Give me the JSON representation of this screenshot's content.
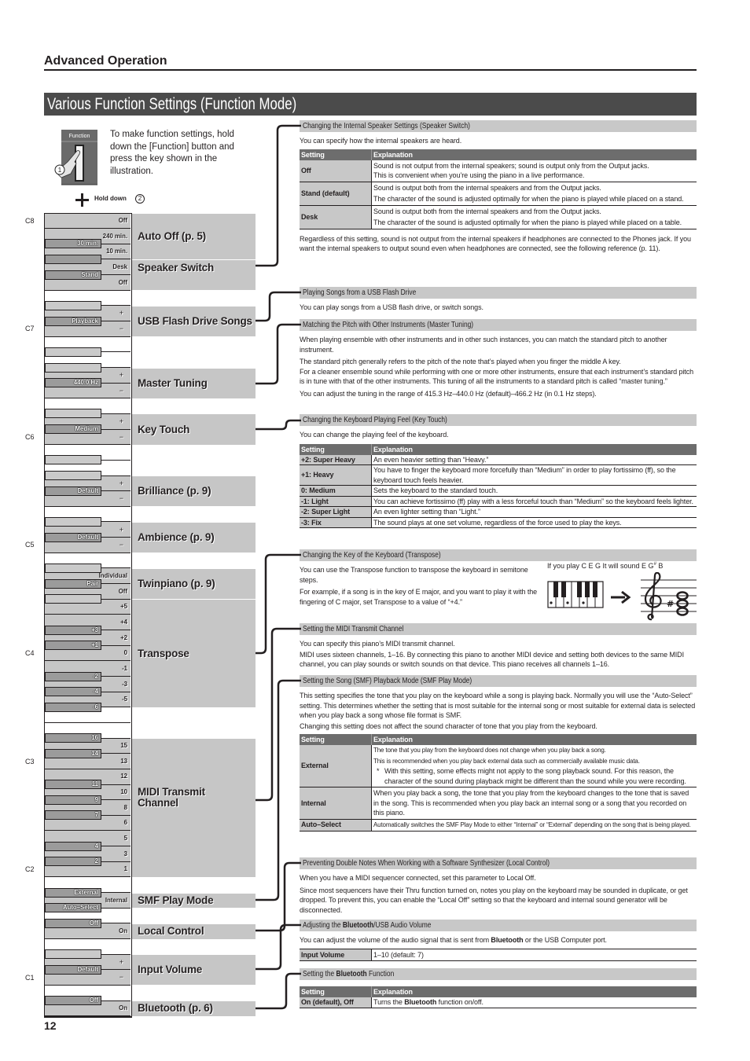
{
  "header": {
    "section": "Advanced Operation",
    "title": "Various Function Settings (Function Mode)"
  },
  "intro": {
    "function_button_label": "Function",
    "step_1": "1",
    "step_2": "2",
    "instruction": "To make function settings, hold down the [Function] button and press the key shown in the illustration.",
    "hold_down": "Hold down",
    "icons": [
      "function-button-icon",
      "pointing-hand-icon",
      "plus-icon"
    ]
  },
  "keyboard": {
    "octave_markers": [
      "C8",
      "C7",
      "C6",
      "C5",
      "C4",
      "C3",
      "C2",
      "C1"
    ],
    "key_labels": {
      "C8": "Off",
      "B7": "240 min.",
      "A#7": "30 min.",
      "A7": "10 min.",
      "G7": "Desk",
      "F#7": "Stand",
      "F7": "Off",
      "D7": "+",
      "C#7": "Playback",
      "C7": "−",
      "G6": "+",
      "F#6": "440.0 Hz",
      "F6": "−",
      "D6": "+",
      "C#6": "Medium",
      "C6": "−",
      "G5": "+",
      "F#5": "Default",
      "F5": "−",
      "D5": "+",
      "C#5": "Default",
      "C5": "−",
      "A4": "Individual",
      "G#4": "Pair",
      "G4": "Off",
      "F4": "+5",
      "E4": "+4",
      "D#4": "+3",
      "D4": "+2",
      "C#4": "+1",
      "C4": "0",
      "B3": "-1",
      "A#3": "-2",
      "A3": "-3",
      "G#3": "-4",
      "G3": "-5",
      "F#3": "-6",
      "D#3": "16",
      "D3": "15",
      "C#3": "14",
      "C3": "13",
      "B2": "12",
      "A#2": "11",
      "A2": "10",
      "G#2": "9",
      "G2": "8",
      "F#2": "7",
      "F2": "6",
      "E2": "5",
      "D#2": "4",
      "D2": "3",
      "C#2": "2",
      "C2": "1",
      "A#1": "External",
      "A1": "Internal",
      "G#1": "Auto–Select",
      "F#1": "Off",
      "F1": "On",
      "D1": "+",
      "C#1": "Default",
      "C1": "−",
      "A#0": "Off",
      "A0": "On"
    },
    "groups": [
      {
        "label": "Auto Off (p. 5)",
        "keys": [
          "C8",
          "A7"
        ]
      },
      {
        "label": "Speaker Switch",
        "keys": [
          "G7",
          "F7"
        ]
      },
      {
        "label": "USB Flash Drive Songs",
        "keys": [
          "D7",
          "C7"
        ]
      },
      {
        "label": "Master Tuning",
        "keys": [
          "G6",
          "F6"
        ]
      },
      {
        "label": "Key Touch",
        "keys": [
          "D6",
          "C6"
        ]
      },
      {
        "label": "Brilliance (p. 9)",
        "keys": [
          "G5",
          "F5"
        ]
      },
      {
        "label": "Ambience (p. 9)",
        "keys": [
          "D5",
          "C5"
        ]
      },
      {
        "label": "Twinpiano (p. 9)",
        "keys": [
          "A4",
          "G4"
        ]
      },
      {
        "label": "Transpose",
        "keys": [
          "F4",
          "G3"
        ]
      },
      {
        "label": "MIDI Transmit\nChannel",
        "keys": [
          "D3",
          "C2"
        ]
      },
      {
        "label": "SMF Play Mode",
        "keys": [
          "A1",
          "A1"
        ]
      },
      {
        "label": "Local Control",
        "keys": [
          "F1",
          "F1"
        ]
      },
      {
        "label": "Input Volume",
        "keys": [
          "D1",
          "C1"
        ]
      },
      {
        "label": "Bluetooth (p. 6)",
        "keys": [
          "A0",
          "A0"
        ]
      }
    ]
  },
  "sections": {
    "speaker_switch": {
      "heading": "Changing the Internal Speaker Settings (Speaker Switch)",
      "intro": "You can specify how the internal speakers are heard.",
      "table": {
        "headers": [
          "Setting",
          "Explanation"
        ],
        "rows": [
          {
            "setting": "Off",
            "explanation": [
              "Sound is not output from the internal speakers; sound is output only from the Output jacks.",
              "This is convenient when you’re using the piano in a live performance."
            ]
          },
          {
            "setting": "Stand (default)",
            "explanation": [
              "Sound is output both from the internal speakers and from the Output jacks.",
              "The character of the sound is adjusted optimally for when the piano is played while placed on a stand."
            ]
          },
          {
            "setting": "Desk",
            "explanation": [
              "Sound is output both from the internal speakers and from the Output jacks.",
              "The character of the sound is adjusted optimally for when the piano is played while placed on a table."
            ]
          }
        ]
      },
      "note": "Regardless of this setting, sound is not output from the internal speakers if headphones are connected to the Phones jack. If you want the internal speakers to output sound even when headphones are connected, see the following reference (p. 11)."
    },
    "usb_flash_drive": {
      "heading": "Playing Songs from a USB Flash Drive",
      "body": [
        "You can play songs from a USB flash drive, or switch songs."
      ]
    },
    "master_tuning": {
      "heading": "Matching the Pitch with Other Instruments (Master Tuning)",
      "body": [
        "When playing ensemble with other instruments and in other such instances, you can match the standard pitch to another instrument.",
        "The standard pitch generally refers to the pitch of the note that’s played when you finger the middle A key.",
        "For a cleaner ensemble sound while performing with one or more other instruments, ensure that each instrument’s standard pitch is in tune with that of the other instruments. This tuning of all the instruments to a standard pitch is called “master tuning.”",
        "You can adjust the tuning in the range of 415.3 Hz–440.0 Hz (default)–466.2 Hz (in 0.1 Hz steps)."
      ]
    },
    "key_touch": {
      "heading": "Changing the Keyboard Playing Feel (Key Touch)",
      "intro": "You can change the playing feel of the keyboard.",
      "table": {
        "headers": [
          "Setting",
          "Explanation"
        ],
        "rows": [
          {
            "setting": "+2: Super Heavy",
            "explanation": "An even heavier setting than “Heavy.”"
          },
          {
            "setting": "+1: Heavy",
            "explanation": "You have to finger the keyboard more forcefully than “Medium” in order to play fortissimo (ff), so the keyboard touch feels heavier."
          },
          {
            "setting": "0: Medium",
            "explanation": "Sets the keyboard to the standard touch."
          },
          {
            "setting": "-1: Light",
            "explanation": "You can achieve fortissimo (ff) play with a less forceful touch than “Medium” so the keyboard feels lighter."
          },
          {
            "setting": "-2: Super Light",
            "explanation": "An even lighter setting than “Light.”"
          },
          {
            "setting": "-3: Fix",
            "explanation": "The sound plays at one set volume, regardless of the force used to play the keys."
          }
        ]
      }
    },
    "transpose": {
      "heading": "Changing the Key of the Keyboard (Transpose)",
      "body": [
        "You can use the Transpose function to transpose the keyboard in semitone steps.",
        "For example, if a song is in the key of E major, and you want to play it with the fingering of C major, set Transpose to a value of “+4.”"
      ],
      "caption": {
        "before": "If you play C E G It will sound E G",
        "sharp": "#",
        "after": " B"
      },
      "illustration_icons": [
        "mini-keyboard-icon",
        "arrow-right-icon",
        "treble-staff-icon"
      ]
    },
    "midi_transmit": {
      "heading": "Setting the MIDI Transmit Channel",
      "body": [
        "You can specify this piano’s MIDI transmit channel.",
        "MIDI uses sixteen channels, 1–16. By connecting this piano to another MIDI device and setting both devices to the same MIDI channel, you can play sounds or switch sounds on that device. This piano receives all channels 1–16."
      ]
    },
    "smf_play_mode": {
      "heading": "Setting the Song (SMF) Playback Mode (SMF Play Mode)",
      "body": [
        "This setting specifies the tone that you play on the keyboard while a song is playing back. Normally you will use the “Auto-Select” setting. This determines whether the setting that is most suitable for the internal song or most suitable for external data is selected when you play back a song whose file format is SMF.",
        "Changing this setting does not affect the sound character of tone that you play from the keyboard."
      ],
      "table": {
        "headers": [
          "Setting",
          "Explanation"
        ],
        "rows": [
          {
            "setting": "External",
            "explanation": [
              "The tone that you play from the keyboard does not change when you play back a song.",
              "This is recommended when you play back external data such as commercially available music data."
            ],
            "note_marker": "*",
            "note": "With this setting, some effects might not apply to the song playback sound. For this reason, the character of the sound during playback might be different than the sound while you were recording."
          },
          {
            "setting": "Internal",
            "explanation": "When you play back a song, the tone that you play from the keyboard changes to the tone that is saved in the song. This is recommended when you play back an internal song or a song that you recorded on this piano."
          },
          {
            "setting": "Auto–Select",
            "explanation": "Automatically switches the SMF Play Mode to either “Internal” or “External” depending on the song that is being played."
          }
        ]
      }
    },
    "local_control": {
      "heading": "Preventing Double Notes When Working with a Software Synthesizer (Local Control)",
      "body": [
        "When you have a MIDI sequencer connected, set this parameter to Local Off.",
        "Since most sequencers have their Thru function turned on, notes you play on the keyboard may be sounded in duplicate, or get dropped. To prevent this, you can enable the “Local Off” setting so that the keyboard and internal sound generator will be disconnected."
      ]
    },
    "input_volume": {
      "heading": [
        "Adjusting the ",
        "Bluetooth",
        "/USB Audio Volume"
      ],
      "body": [
        "You can adjust the volume of the audio signal that is sent from ",
        "Bluetooth",
        " or the USB Computer port."
      ],
      "table": {
        "setting": "Input Volume",
        "value": "1–10 (default: 7)"
      }
    },
    "bluetooth": {
      "heading": [
        "Setting the ",
        "Bluetooth",
        " Function"
      ],
      "table": {
        "headers": [
          "Setting",
          "Explanation"
        ],
        "rows": [
          {
            "setting": "On (default), Off",
            "explanation": [
              "Turns the ",
              "Bluetooth",
              " function on/off."
            ]
          }
        ]
      }
    }
  },
  "page_number": "12"
}
